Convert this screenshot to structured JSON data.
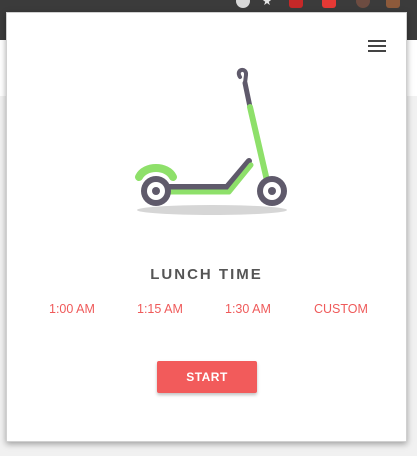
{
  "popup": {
    "title": "LUNCH TIME",
    "options": [
      "1:00 AM",
      "1:15 AM",
      "1:30 AM",
      "CUSTOM"
    ],
    "start_label": "START",
    "menu_icon": "hamburger-menu-icon",
    "illustration": "scooter-icon"
  },
  "colors": {
    "accent": "#f25b5b",
    "scooter_green": "#8ee06a",
    "scooter_dark": "#5f5a6b",
    "title": "#555555"
  }
}
